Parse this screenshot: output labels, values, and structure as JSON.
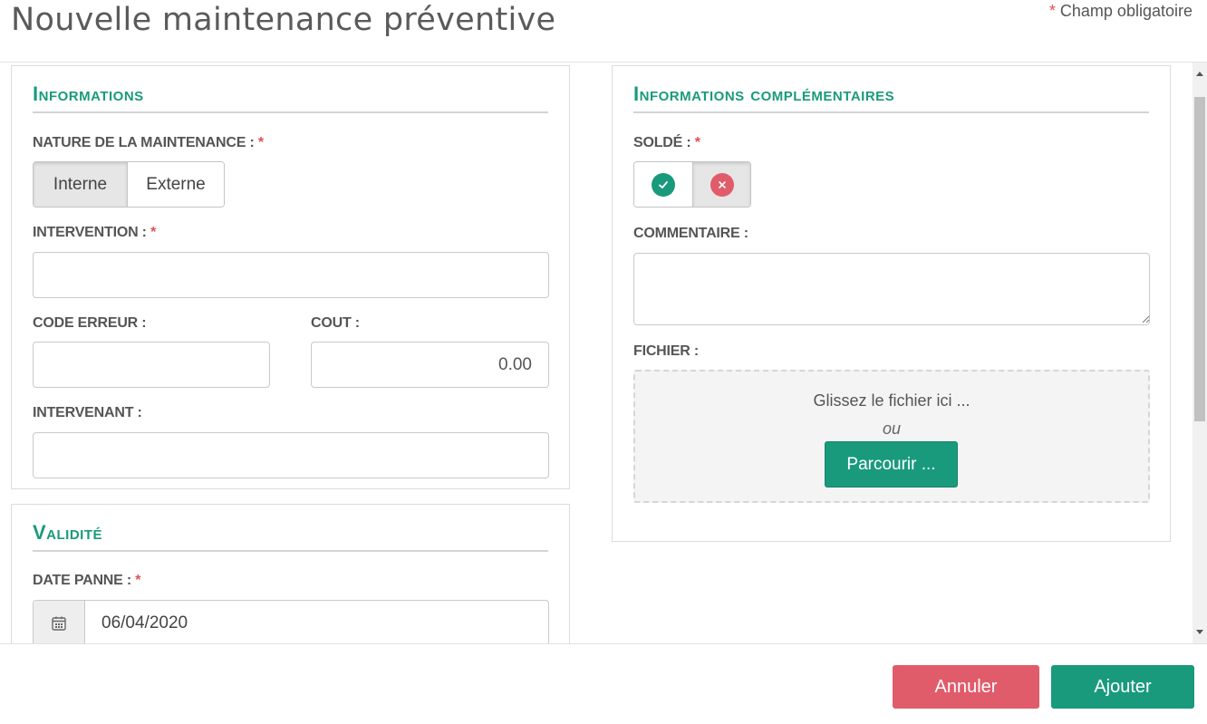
{
  "header": {
    "title": "Nouvelle maintenance préventive",
    "required_star": "*",
    "required_note": "Champ obligatoire"
  },
  "informations": {
    "title": "Informations",
    "nature_label": "NATURE DE LA MAINTENANCE :",
    "nature_options": [
      "Interne",
      "Externe"
    ],
    "nature_selected": "Interne",
    "intervention_label": "INTERVENTION :",
    "intervention_value": "",
    "code_erreur_label": "CODE ERREUR :",
    "code_erreur_value": "",
    "cout_label": "COUT :",
    "cout_value": "0.00",
    "intervenant_label": "INTERVENANT :",
    "intervenant_value": ""
  },
  "validite": {
    "title": "Validité",
    "date_panne_label": "DATE PANNE :",
    "date_panne_value": "06/04/2020"
  },
  "complementaires": {
    "title": "Informations complémentaires",
    "solde_label": "SOLDÉ :",
    "solde_selected": "no",
    "commentaire_label": "COMMENTAIRE :",
    "commentaire_value": "",
    "fichier_label": "FICHIER :",
    "dropzone_text": "Glissez le fichier ici ...",
    "dropzone_or": "ou",
    "browse_label": "Parcourir ..."
  },
  "footer": {
    "cancel_label": "Annuler",
    "add_label": "Ajouter"
  },
  "colors": {
    "accent": "#1a9a7c",
    "danger": "#e05c6b",
    "required": "#e05252"
  }
}
